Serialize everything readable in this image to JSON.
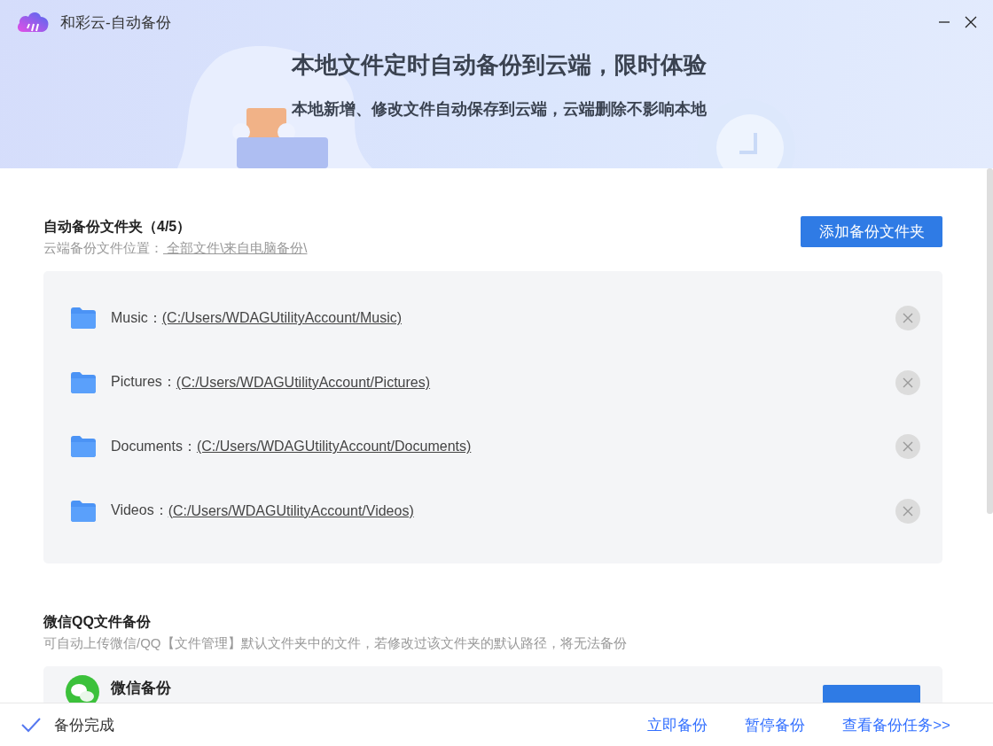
{
  "window": {
    "title": "和彩云-自动备份"
  },
  "banner": {
    "headline": "本地文件定时自动备份到云端，限时体验",
    "subtitle": "本地新增、修改文件自动保存到云端，云端删除不影响本地"
  },
  "auto_backup": {
    "title": "自动备份文件夹（4/5）",
    "location_label": "云端备份文件位置：",
    "location_link": " 全部文件\\来自电脑备份\\",
    "add_button": "添加备份文件夹",
    "folders": [
      {
        "name": "Music：",
        "path": "(C:/Users/WDAGUtilityAccount/Music)"
      },
      {
        "name": "Pictures：",
        "path": "(C:/Users/WDAGUtilityAccount/Pictures)"
      },
      {
        "name": "Documents：",
        "path": "(C:/Users/WDAGUtilityAccount/Documents)"
      },
      {
        "name": "Videos：",
        "path": "(C:/Users/WDAGUtilityAccount/Videos)"
      }
    ]
  },
  "wechat_qq": {
    "title": "微信QQ文件备份",
    "description": "可自动上传微信/QQ【文件管理】默认文件夹中的文件，若修改过该文件夹的默认路径，将无法备份",
    "items": [
      {
        "name": "微信备份"
      }
    ]
  },
  "status_bar": {
    "status": "备份完成",
    "actions": [
      "立即备份",
      "暂停备份",
      "查看备份任务>>"
    ]
  }
}
